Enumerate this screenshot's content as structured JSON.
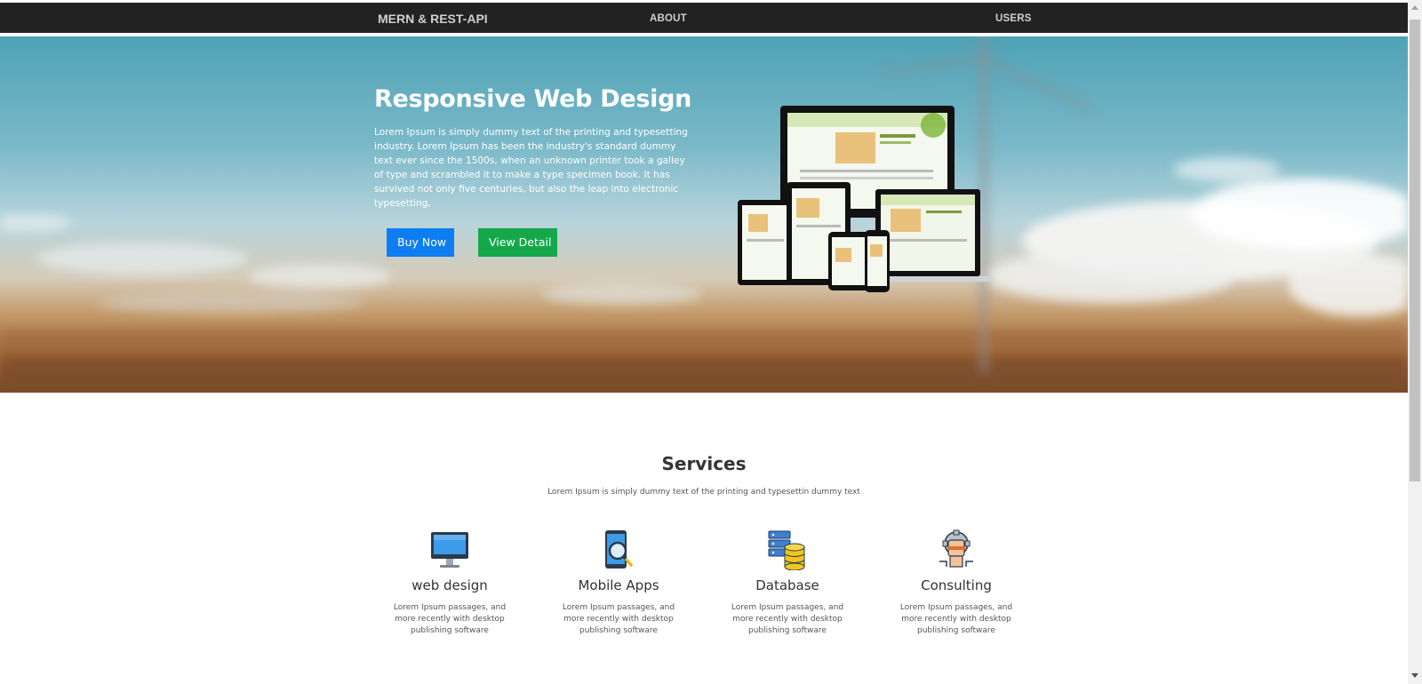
{
  "navbar": {
    "brand": "MERN & REST-API",
    "links": [
      {
        "label": "ABOUT"
      },
      {
        "label": "USERS"
      }
    ]
  },
  "hero": {
    "title": "Responsive Web Design",
    "text": "Lorem Ipsum is simply dummy text of the printing and typesetting industry. Lorem Ipsum has been the industry's standard dummy text ever since the 1500s, when an unknown printer took a galley of type and scrambled it to make a type specimen book. It has survived not only five centuries, but also the leap into electronic typesetting,",
    "buy_label": "Buy Now",
    "view_label": "View Detail",
    "image_icon": "responsive-devices-image"
  },
  "services": {
    "title": "Services",
    "subtitle": "Lorem Ipsum is simply dummy text of the printing and typesettin dummy text",
    "items": [
      {
        "name": "web design",
        "icon": "monitor-icon",
        "desc": "Lorem Ipsum passages, and more recently with desktop publishing software"
      },
      {
        "name": "Mobile Apps",
        "icon": "mobile-search-icon",
        "desc": "Lorem Ipsum passages, and more recently with desktop publishing software"
      },
      {
        "name": "Database",
        "icon": "database-icon",
        "desc": "Lorem Ipsum passages, and more recently with desktop publishing software"
      },
      {
        "name": "Consulting",
        "icon": "consulting-gear-icon",
        "desc": "Lorem Ipsum passages, and more recently with desktop publishing software"
      }
    ]
  },
  "colors": {
    "navbar_bg": "#222222",
    "buy_button": "#0d7df2",
    "view_button": "#14a84a"
  }
}
